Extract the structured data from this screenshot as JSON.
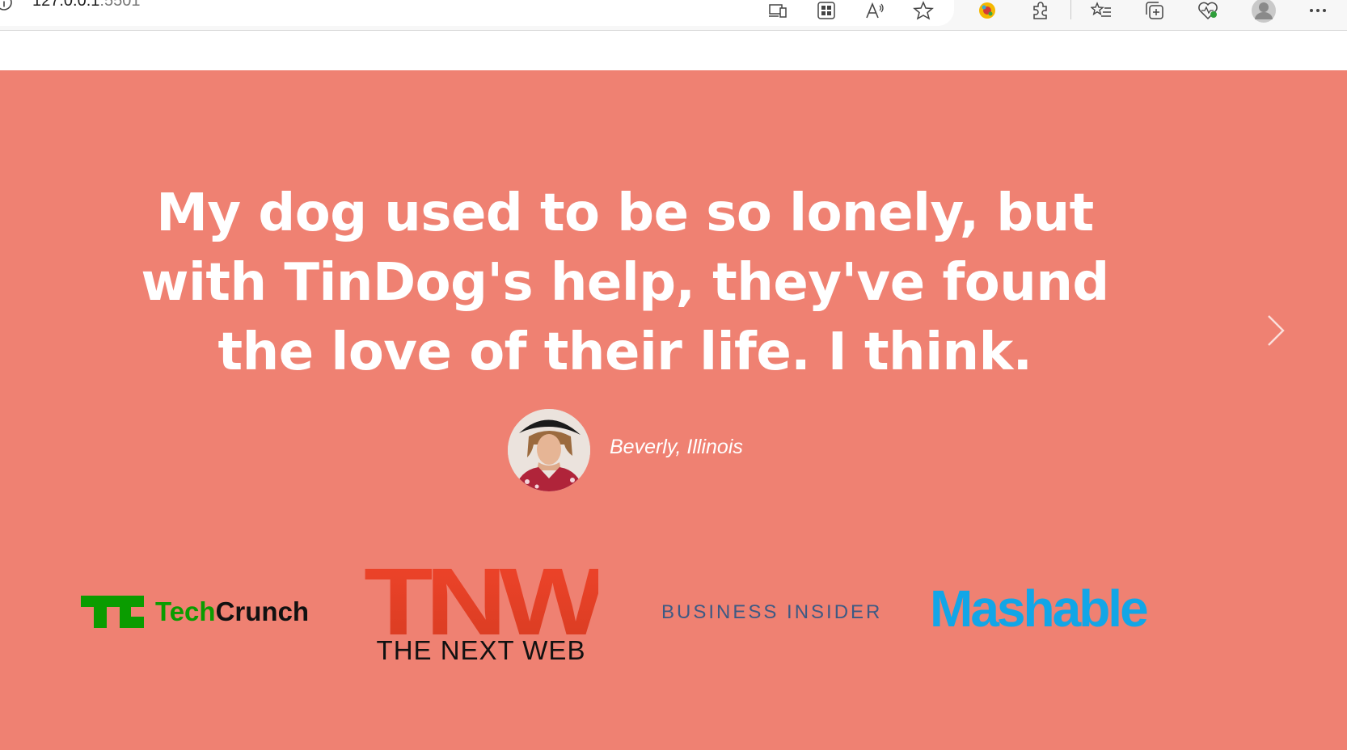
{
  "browser": {
    "url_host": "127.0.0.1",
    "url_port": ":5501",
    "toolbar_icons": [
      "device-screen-icon",
      "apps-grid-icon",
      "read-aloud-icon",
      "favorite-star-icon",
      "extension-colorful-icon",
      "extensions-puzzle-icon",
      "favorites-list-icon",
      "collections-icon",
      "browser-essentials-icon",
      "profile-avatar-icon",
      "more-menu-icon"
    ]
  },
  "testimonial": {
    "quote": "My dog used to be so lonely, but with TinDog's help, they've found the love of their life. I think.",
    "author": "Beverly, Illinois",
    "next_control": "chevron-right-icon"
  },
  "press": {
    "techcrunch_prefix": "Tech",
    "techcrunch_suffix": "Crunch",
    "tnw_letters": "TNW",
    "tnw_name": "THE NEXT WEB",
    "business_insider": "BUSINESS INSIDER",
    "mashable": "Mashable"
  },
  "colors": {
    "section_background": "#ef8172",
    "text": "#ffffff",
    "techcrunch_green": "#0a9c00",
    "tnw_orange": "#ea4a26",
    "business_insider_blue": "#3d5a84",
    "mashable_blue": "#12a6e7"
  }
}
